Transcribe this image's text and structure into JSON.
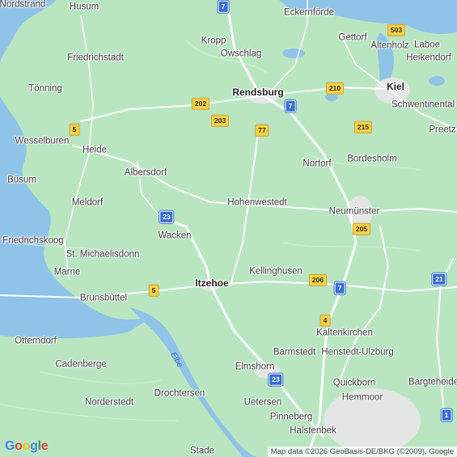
{
  "places": [
    {
      "id": "nordstrand",
      "label": "Nordstrand"
    },
    {
      "id": "husum",
      "label": "Husum"
    },
    {
      "id": "eckernforde",
      "label": "Eckernförde"
    },
    {
      "id": "kropp",
      "label": "Kropp"
    },
    {
      "id": "gettorf",
      "label": "Gettorf"
    },
    {
      "id": "altenholz",
      "label": "Altenholz"
    },
    {
      "id": "laboe",
      "label": "Laboe"
    },
    {
      "id": "heikendorf",
      "label": "Heikendorf"
    },
    {
      "id": "friedrichstadt",
      "label": "Friedrichstadt"
    },
    {
      "id": "owschlag",
      "label": "Owschlag"
    },
    {
      "id": "tonning",
      "label": "Tönning"
    },
    {
      "id": "rendsburg",
      "label": "Rendsburg"
    },
    {
      "id": "kiel",
      "label": "Kiel"
    },
    {
      "id": "schwentinental",
      "label": "Schwentinental"
    },
    {
      "id": "preetz",
      "label": "Preetz"
    },
    {
      "id": "wesselburen",
      "label": "Wesselburen"
    },
    {
      "id": "heide",
      "label": "Heide"
    },
    {
      "id": "nortorf",
      "label": "Nortorf"
    },
    {
      "id": "bordesholm",
      "label": "Bordesholm"
    },
    {
      "id": "albersdorf",
      "label": "Albersdorf"
    },
    {
      "id": "busum",
      "label": "Büsum"
    },
    {
      "id": "meldorf",
      "label": "Meldorf"
    },
    {
      "id": "hohenwestedt",
      "label": "Hohenwestedt"
    },
    {
      "id": "neumunster",
      "label": "Neumünster"
    },
    {
      "id": "friedrichskoog",
      "label": "Friedrichskoog"
    },
    {
      "id": "wacken",
      "label": "Wacken"
    },
    {
      "id": "stmichaelisdonn",
      "label": "St. Michaelisdonn"
    },
    {
      "id": "kellinghusen",
      "label": "Kellinghusen"
    },
    {
      "id": "marne",
      "label": "Marne"
    },
    {
      "id": "itzehoe",
      "label": "Itzehoe"
    },
    {
      "id": "brunsbuttel",
      "label": "Brunsbüttel"
    },
    {
      "id": "kaltenkirchen",
      "label": "Kaltenkirchen"
    },
    {
      "id": "otterndorf",
      "label": "Otterndorf"
    },
    {
      "id": "barmstedt",
      "label": "Barmstedt"
    },
    {
      "id": "henstedt",
      "label": "Henstedt-Ulzburg"
    },
    {
      "id": "cadenberge",
      "label": "Cadenberge"
    },
    {
      "id": "elmshorn",
      "label": "Elmshorn"
    },
    {
      "id": "quickborn",
      "label": "Quickborn"
    },
    {
      "id": "bargteheide",
      "label": "Bargteheide"
    },
    {
      "id": "drochtersen",
      "label": "Drochtersen"
    },
    {
      "id": "hemmoor",
      "label": "Hemmoor"
    },
    {
      "id": "norderstedt",
      "label": "Norderstedt"
    },
    {
      "id": "uetersen",
      "label": "Uetersen"
    },
    {
      "id": "pinneberg",
      "label": "Pinneberg"
    },
    {
      "id": "halstenbek",
      "label": "Halstenbek"
    },
    {
      "id": "stade",
      "label": "Stade"
    }
  ],
  "shields": [
    {
      "id": "a7-top",
      "label": "7",
      "type": "autobahn"
    },
    {
      "id": "b503",
      "label": "503",
      "type": "bundesstrasse"
    },
    {
      "id": "b210",
      "label": "210",
      "type": "bundesstrasse"
    },
    {
      "id": "b202",
      "label": "202",
      "type": "bundesstrasse"
    },
    {
      "id": "a7-mid",
      "label": "7",
      "type": "autobahn"
    },
    {
      "id": "b203",
      "label": "203",
      "type": "bundesstrasse"
    },
    {
      "id": "b215",
      "label": "215",
      "type": "bundesstrasse"
    },
    {
      "id": "b5-north",
      "label": "5",
      "type": "bundesstrasse"
    },
    {
      "id": "b77",
      "label": "77",
      "type": "bundesstrasse"
    },
    {
      "id": "a23-north",
      "label": "23",
      "type": "autobahn"
    },
    {
      "id": "b205",
      "label": "205",
      "type": "bundesstrasse"
    },
    {
      "id": "b206",
      "label": "206",
      "type": "bundesstrasse"
    },
    {
      "id": "a7-south",
      "label": "7",
      "type": "autobahn"
    },
    {
      "id": "a21",
      "label": "21",
      "type": "autobahn"
    },
    {
      "id": "b5-south",
      "label": "5",
      "type": "bundesstrasse"
    },
    {
      "id": "b4",
      "label": "4",
      "type": "bundesstrasse"
    },
    {
      "id": "a23-south",
      "label": "23",
      "type": "autobahn"
    },
    {
      "id": "a1",
      "label": "1",
      "type": "autobahn"
    }
  ],
  "river_label": "Elbe",
  "logo": "Google",
  "attribution": "Map data ©2026 GeoBasis-DE/BKG (©2009), Google",
  "colors": {
    "land": "#b9e6c1",
    "water": "#8fc3e8",
    "road": "#ffffff",
    "autobahn_shield": "#3a6fd1",
    "bundesstrasse_shield": "#f6d049",
    "urban": "#e3e6e4"
  }
}
